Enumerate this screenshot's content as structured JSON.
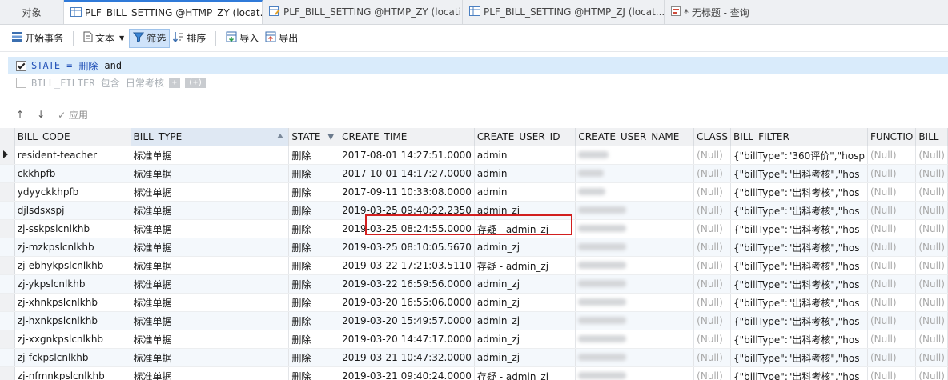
{
  "tabs": [
    {
      "label": "对象",
      "icon": "",
      "active": false
    },
    {
      "label": "PLF_BILL_SETTING @HTMP_ZY (locat...",
      "icon": "table-icon",
      "active": true
    },
    {
      "label": "PLF_BILL_SETTING @HTMP_ZY (locati...",
      "icon": "table-edit-icon",
      "active": false
    },
    {
      "label": "PLF_BILL_SETTING @HTMP_ZJ (locat...",
      "icon": "table-icon",
      "active": false
    },
    {
      "label": "* 无标题 - 查询",
      "icon": "query-icon",
      "active": false
    }
  ],
  "toolbar": {
    "begin_tx": "开始事务",
    "text": "文本",
    "filter": "筛选",
    "sort": "排序",
    "import": "导入",
    "export": "导出"
  },
  "filters": {
    "row1": {
      "field": "STATE",
      "op": "=",
      "value": "删除",
      "conj": "and",
      "checked": true
    },
    "row2": {
      "text": "BILL_FILTER 包含 日常考核",
      "checked": false
    }
  },
  "nav": {
    "up": "↑",
    "down": "↓",
    "apply": "✓ 应用"
  },
  "columns": [
    "BILL_CODE",
    "BILL_TYPE",
    "STATE",
    "CREATE_TIME",
    "CREATE_USER_ID",
    "CREATE_USER_NAME",
    "CLASS",
    "BILL_FILTER",
    "FUNCTIO",
    "BILL_"
  ],
  "rows": [
    {
      "code": "resident-teacher",
      "type": "标准单据",
      "state": "删除",
      "time": "2017-08-01 14:27:51.0000",
      "user": "admin",
      "cls": "(Null)",
      "filter": "{\"billType\":\"360评价\",\"hosp",
      "func": "(Null)",
      "bill": "(Null)"
    },
    {
      "code": "ckkhpfb",
      "type": "标准单据",
      "state": "删除",
      "time": "2017-10-01 14:17:27.0000",
      "user": "admin",
      "cls": "(Null)",
      "filter": "{\"billType\":\"出科考核\",\"hos",
      "func": "(Null)",
      "bill": "(Null)"
    },
    {
      "code": "ydyyckkhpfb",
      "type": "标准单据",
      "state": "删除",
      "time": "2017-09-11 10:33:08.0000",
      "user": "admin",
      "cls": "(Null)",
      "filter": "{\"billType\":\"出科考核\",\"hos",
      "func": "(Null)",
      "bill": "(Null)"
    },
    {
      "code": "djlsdsxspj",
      "type": "标准单据",
      "state": "删除",
      "time": "2019-03-25 09:40:22.2350",
      "user": "admin_zj",
      "cls": "(Null)",
      "filter": "{\"billType\":\"出科考核\",\"hos",
      "func": "(Null)",
      "bill": "(Null)"
    },
    {
      "code": "zj-sskpslcnlkhb",
      "type": "标准单据",
      "state": "删除",
      "time": "2019-03-25 08:24:55.0000",
      "user": "存疑 - admin_zj",
      "cls": "(Null)",
      "filter": "{\"billType\":\"出科考核\",\"hos",
      "func": "(Null)",
      "bill": "(Null)"
    },
    {
      "code": "zj-mzkpslcnlkhb",
      "type": "标准单据",
      "state": "删除",
      "time": "2019-03-25 08:10:05.5670",
      "user": "admin_zj",
      "cls": "(Null)",
      "filter": "{\"billType\":\"出科考核\",\"hos",
      "func": "(Null)",
      "bill": "(Null)"
    },
    {
      "code": "zj-ebhykpslcnlkhb",
      "type": "标准单据",
      "state": "删除",
      "time": "2019-03-22 17:21:03.5110",
      "user": "存疑 - admin_zj",
      "cls": "(Null)",
      "filter": "{\"billType\":\"出科考核\",\"hos",
      "func": "(Null)",
      "bill": "(Null)"
    },
    {
      "code": "zj-ykpslcnlkhb",
      "type": "标准单据",
      "state": "删除",
      "time": "2019-03-22 16:59:56.0000",
      "user": "admin_zj",
      "cls": "(Null)",
      "filter": "{\"billType\":\"出科考核\",\"hos",
      "func": "(Null)",
      "bill": "(Null)"
    },
    {
      "code": "zj-xhnkpslcnlkhb",
      "type": "标准单据",
      "state": "删除",
      "time": "2019-03-20 16:55:06.0000",
      "user": "admin_zj",
      "cls": "(Null)",
      "filter": "{\"billType\":\"出科考核\",\"hos",
      "func": "(Null)",
      "bill": "(Null)"
    },
    {
      "code": "zj-hxnkpslcnlkhb",
      "type": "标准单据",
      "state": "删除",
      "time": "2019-03-20 15:49:57.0000",
      "user": "admin_zj",
      "cls": "(Null)",
      "filter": "{\"billType\":\"出科考核\",\"hos",
      "func": "(Null)",
      "bill": "(Null)"
    },
    {
      "code": "zj-xxgnkpslcnlkhb",
      "type": "标准单据",
      "state": "删除",
      "time": "2019-03-20 14:47:17.0000",
      "user": "admin_zj",
      "cls": "(Null)",
      "filter": "{\"billType\":\"出科考核\",\"hos",
      "func": "(Null)",
      "bill": "(Null)"
    },
    {
      "code": "zj-fckpslcnlkhb",
      "type": "标准单据",
      "state": "删除",
      "time": "2019-03-21 10:47:32.0000",
      "user": "admin_zj",
      "cls": "(Null)",
      "filter": "{\"billType\":\"出科考核\",\"hos",
      "func": "(Null)",
      "bill": "(Null)"
    },
    {
      "code": "zj-nfmnkpslcnlkhb",
      "type": "标准单据",
      "state": "删除",
      "time": "2019-03-21 09:40:24.0000",
      "user": "存疑 - admin_zj",
      "cls": "(Null)",
      "filter": "{\"billType\":\"出科考核\",\"hos",
      "func": "(Null)",
      "bill": "(Null)"
    }
  ]
}
